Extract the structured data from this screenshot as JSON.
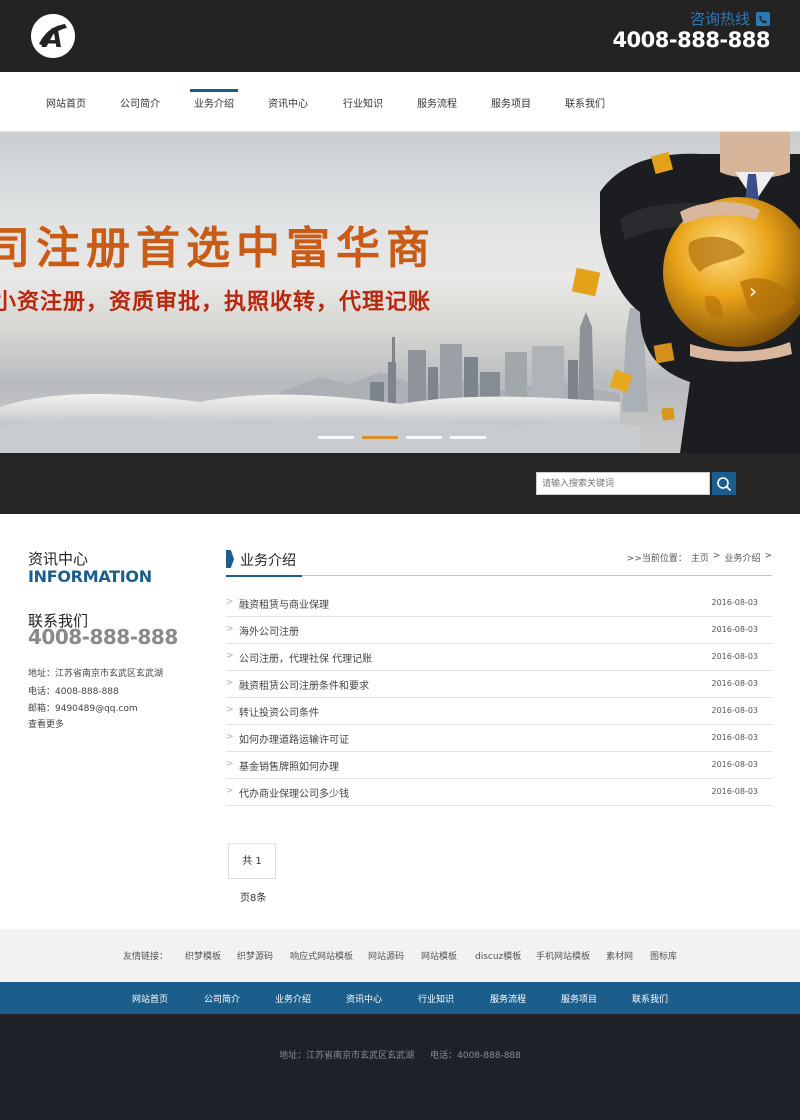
{
  "header": {
    "logo_letter": "A",
    "hotline_label": "咨询热线",
    "hotline_number": "4008-888-888"
  },
  "nav": {
    "items": [
      "网站首页",
      "公司简介",
      "业务介绍",
      "资讯中心",
      "行业知识",
      "服务流程",
      "服务项目",
      "联系我们"
    ],
    "active_index": 2
  },
  "banner": {
    "title": "司注册首选中富华商",
    "subtitle": "小资注册，资质审批，执照收转，代理记账",
    "slides_total": 4,
    "active_slide": 1
  },
  "search": {
    "placeholder": "请输入搜索关键词"
  },
  "sidebar": {
    "info_cn": "资讯中心",
    "info_en": "INFORMATION",
    "contact_cn": "联系我们",
    "contact_number": "4008-888-888",
    "address": "地址：江苏省南京市玄武区玄武湖",
    "phone": "电话：4008-888-888",
    "email": "邮箱：9490489@qq.com",
    "more": "查看更多"
  },
  "main": {
    "title": "业务介绍",
    "breadcrumb_prefix": ">>当前位置：",
    "breadcrumb_home": "主页",
    "breadcrumb_current": "业务介绍",
    "articles": [
      {
        "title": "融资租赁与商业保理",
        "date": "2016-08-03"
      },
      {
        "title": "海外公司注册",
        "date": "2016-08-03"
      },
      {
        "title": "公司注册，代理社保 代理记账",
        "date": "2016-08-03"
      },
      {
        "title": "融资租赁公司注册条件和要求",
        "date": "2016-08-03"
      },
      {
        "title": "转让投资公司条件",
        "date": "2016-08-03"
      },
      {
        "title": "如何办理道路运输许可证",
        "date": "2016-08-03"
      },
      {
        "title": "基金销售牌照如何办理",
        "date": "2016-08-03"
      },
      {
        "title": "代办商业保理公司多少钱",
        "date": "2016-08-03"
      }
    ],
    "pager_box": "共 1",
    "pager_tail": "页8条"
  },
  "friend_links": {
    "label": "友情链接：",
    "items": [
      "织梦模板",
      "织梦源码",
      "响应式网站模板",
      "网站源码",
      "网站模板",
      "discuz模板",
      "手机网站模板",
      "素材网",
      "图标库"
    ]
  },
  "footer_nav": {
    "items": [
      "网站首页",
      "公司简介",
      "业务介绍",
      "资讯中心",
      "行业知识",
      "服务流程",
      "服务项目",
      "联系我们"
    ]
  },
  "footer": {
    "address": "地址：江苏省南京市玄武区玄武湖",
    "phone": "电话：4008-888-888"
  },
  "colors": {
    "brand_blue": "#1b5e8c",
    "header_dark": "#232323",
    "banner_orange": "#c95b14",
    "banner_red": "#b8280e",
    "slide_active": "#d98a1a"
  }
}
